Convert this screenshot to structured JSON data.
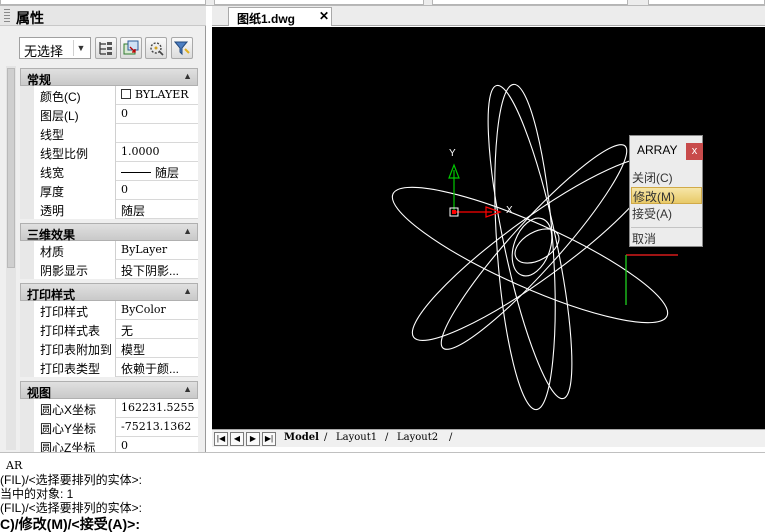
{
  "document_tab": {
    "title": "图纸1.dwg",
    "close_glyph": "✕"
  },
  "properties_panel": {
    "title": "属性",
    "selection_value": "无选择",
    "sections": [
      {
        "name": "常规",
        "rows": [
          {
            "name": "颜色(C)",
            "value": "BYLAYER"
          },
          {
            "name": "图层(L)",
            "value": "0"
          },
          {
            "name": "线型",
            "value": ""
          },
          {
            "name": "线型比例",
            "value": "1.0000"
          },
          {
            "name": "线宽",
            "value": "随层"
          },
          {
            "name": "厚度",
            "value": "0"
          },
          {
            "name": "透明",
            "value": "随层"
          }
        ]
      },
      {
        "name": "三维效果",
        "rows": [
          {
            "name": "材质",
            "value": "ByLayer"
          },
          {
            "name": "阴影显示",
            "value": "投下阴影..."
          }
        ]
      },
      {
        "name": "打印样式",
        "rows": [
          {
            "name": "打印样式",
            "value": "ByColor"
          },
          {
            "name": "打印样式表",
            "value": "无"
          },
          {
            "name": "打印表附加到",
            "value": "模型"
          },
          {
            "name": "打印表类型",
            "value": "依赖于颜..."
          }
        ]
      },
      {
        "name": "视图",
        "rows": [
          {
            "name": "圆心X坐标",
            "value": "162231.5255"
          },
          {
            "name": "圆心Y坐标",
            "value": "-75213.1362"
          },
          {
            "name": "圆心Z坐标",
            "value": "0"
          }
        ]
      }
    ]
  },
  "array_menu": {
    "title": "ARRAY",
    "close_glyph": "x",
    "items": [
      "关闭(C)",
      "修改(M)",
      "接受(A)",
      "取消"
    ],
    "active_item": "修改(M)"
  },
  "ucs": {
    "y_label": "Y",
    "x_label": "X"
  },
  "layout_tabs": [
    "Model",
    "Layout1",
    "Layout2"
  ],
  "command_lines": [
    "AR",
    "(FIL)/<选择要排列的实体>:",
    "当中的对象: 1",
    "(FIL)/<选择要排列的实体>:",
    "C)/修改(M)/<接受(A)>:"
  ],
  "colors": {
    "canvas_bg": "#000000",
    "geometry": "#ffffff",
    "ucs_x": "#ff0000",
    "ucs_y": "#00c800",
    "cursor_x": "#ff2020",
    "cursor_y": "#20d020",
    "menu_active": "#ebcc6a",
    "menu_close": "#c84b4b"
  }
}
